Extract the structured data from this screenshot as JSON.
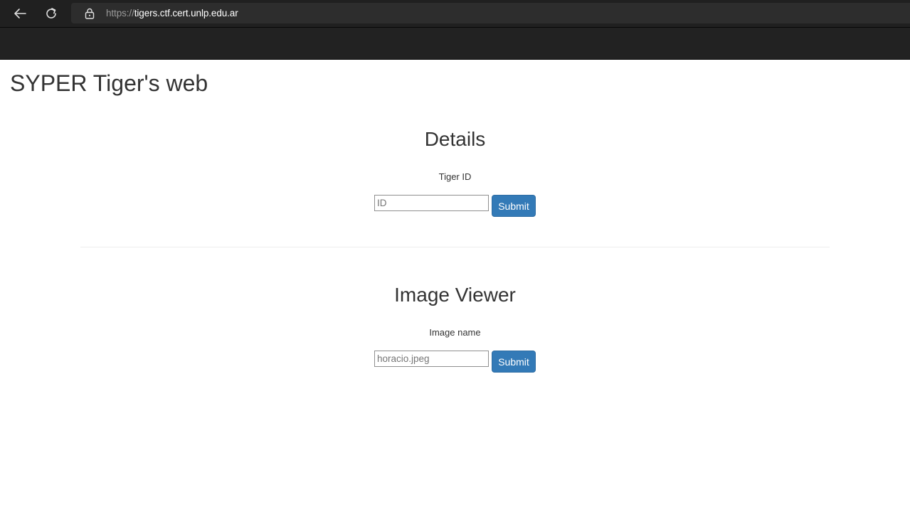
{
  "browser": {
    "url_scheme": "https://",
    "url_host": "tigers.ctf.cert.unlp.edu.ar"
  },
  "site": {
    "title": "SYPER Tiger's web"
  },
  "details": {
    "heading": "Details",
    "label": "Tiger ID",
    "input_placeholder": "ID",
    "submit_label": "Submit"
  },
  "image_viewer": {
    "heading": "Image Viewer",
    "label": "Image name",
    "input_placeholder": "horacio.jpeg",
    "submit_label": "Submit"
  },
  "colors": {
    "navbar": "#222222",
    "button_primary": "#337ab7",
    "text": "#333333"
  },
  "icons": [
    "back-arrow-icon",
    "reload-icon",
    "lock-icon"
  ]
}
